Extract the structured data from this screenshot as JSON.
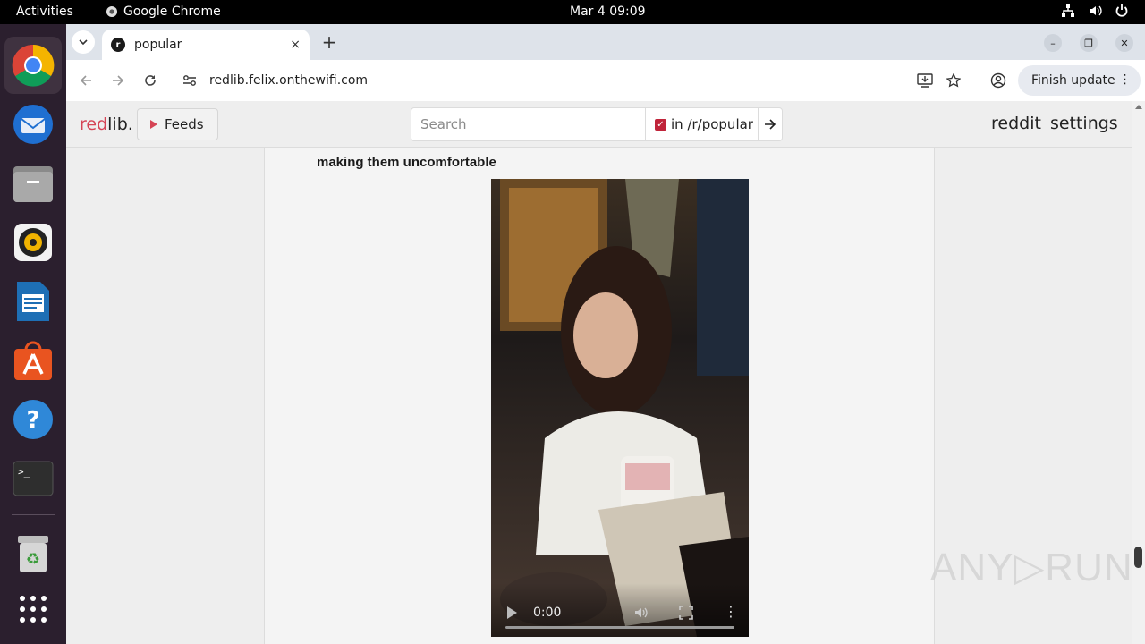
{
  "topbar": {
    "activities": "Activities",
    "app_name": "Google Chrome",
    "clock": "Mar 4  09:09",
    "tray_icons": [
      "network-icon",
      "volume-icon",
      "power-icon"
    ]
  },
  "dock": {
    "items": [
      "chrome-icon",
      "thunderbird-icon",
      "files-icon",
      "rhythmbox-icon",
      "libreoffice-writer-icon",
      "app-center-icon",
      "help-icon",
      "terminal-icon",
      "trash-icon",
      "app-grid-icon"
    ]
  },
  "browser": {
    "tab_title": "popular",
    "tab_close": "×",
    "new_tab": "+",
    "url": "redlib.felix.onthewifi.com",
    "update_button": "Finish update",
    "window_controls": [
      "–",
      "❐",
      "✕"
    ]
  },
  "redlib": {
    "brand_red": "red",
    "brand_rest": "lib.",
    "feeds_label": "Feeds",
    "search_placeholder": "Search",
    "scope_label": "in /r/popular",
    "scope_checked": true,
    "nav_reddit": "reddit",
    "nav_settings": "settings",
    "accent_color": "#d54455"
  },
  "post": {
    "title_fragment": "making them uncomfortable",
    "video": {
      "time": "0:00"
    }
  },
  "watermark": "ANY▷RUN"
}
